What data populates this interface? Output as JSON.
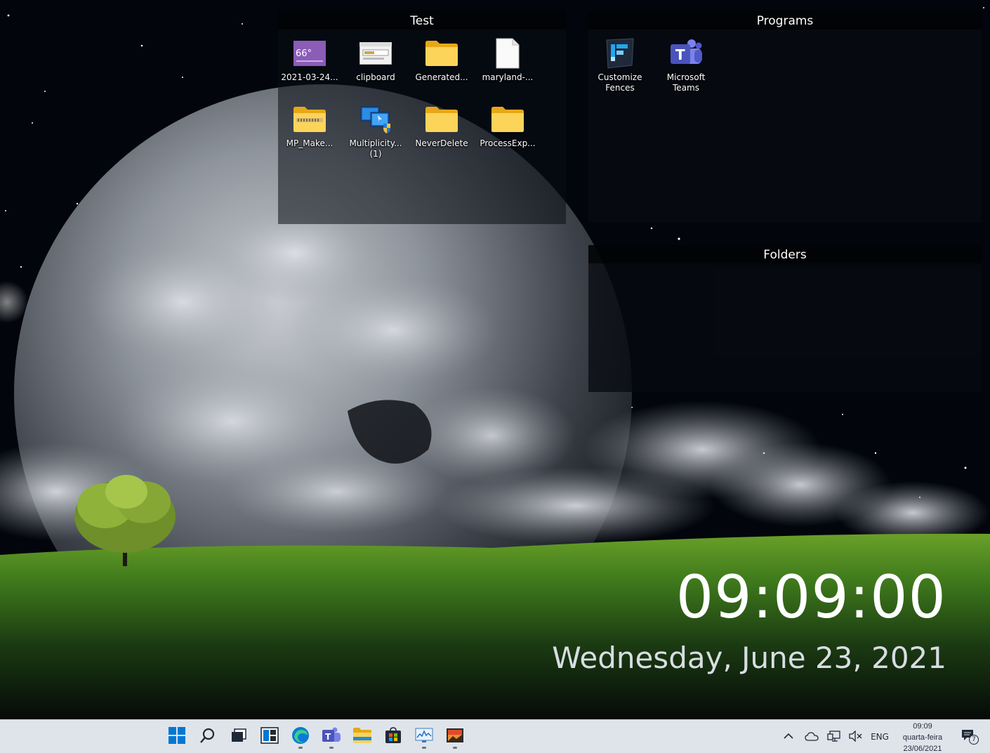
{
  "fences": {
    "test": {
      "title": "Test",
      "items": [
        {
          "label": "2021-03-24...",
          "icon": "screenshot-thumbnail-icon"
        },
        {
          "label": "clipboard",
          "icon": "clipboard-app-icon"
        },
        {
          "label": "Generated...",
          "icon": "folder-icon"
        },
        {
          "label": "maryland-...",
          "icon": "blank-file-icon"
        },
        {
          "label": "MP_Make...",
          "icon": "zip-folder-icon"
        },
        {
          "label": "Multiplicity...\n(1)",
          "icon": "multiplicity-installer-icon"
        },
        {
          "label": "NeverDelete",
          "icon": "folder-icon"
        },
        {
          "label": "ProcessExp...",
          "icon": "folder-icon"
        }
      ],
      "thumbnail_text": "66°"
    },
    "programs": {
      "title": "Programs",
      "items": [
        {
          "label": "Customize\nFences",
          "icon": "fences-app-icon"
        },
        {
          "label": "Microsoft\nTeams",
          "icon": "teams-icon"
        }
      ]
    },
    "folders": {
      "title": "Folders",
      "items": []
    }
  },
  "clock": {
    "time": "09:09:00",
    "date": "Wednesday, June 23, 2021"
  },
  "taskbar": {
    "pinned": [
      {
        "name": "start-button",
        "icon": "windows-logo-icon",
        "running": false
      },
      {
        "name": "search-button",
        "icon": "search-icon",
        "running": false
      },
      {
        "name": "task-view-button",
        "icon": "task-view-icon",
        "running": false
      },
      {
        "name": "widgets-button",
        "icon": "widgets-icon",
        "running": false
      },
      {
        "name": "edge-button",
        "icon": "edge-icon",
        "running": true
      },
      {
        "name": "teams-button",
        "icon": "teams-icon",
        "running": true
      },
      {
        "name": "file-explorer-button",
        "icon": "folder-icon",
        "running": false
      },
      {
        "name": "store-button",
        "icon": "store-icon",
        "running": false
      },
      {
        "name": "resource-monitor-button",
        "icon": "monitor-chart-icon",
        "running": true
      },
      {
        "name": "photos-button",
        "icon": "photos-icon",
        "running": true
      }
    ],
    "tray": {
      "language": "ENG",
      "time": "09:09",
      "day": "quarta-feira",
      "date": "23/06/2021",
      "notification_count": "7"
    }
  },
  "colors": {
    "taskbar_bg": "#dfe4ea",
    "windows_blue": "#0078d4",
    "folder_yellow": "#f8c73e",
    "teams_purple": "#5059c9"
  }
}
